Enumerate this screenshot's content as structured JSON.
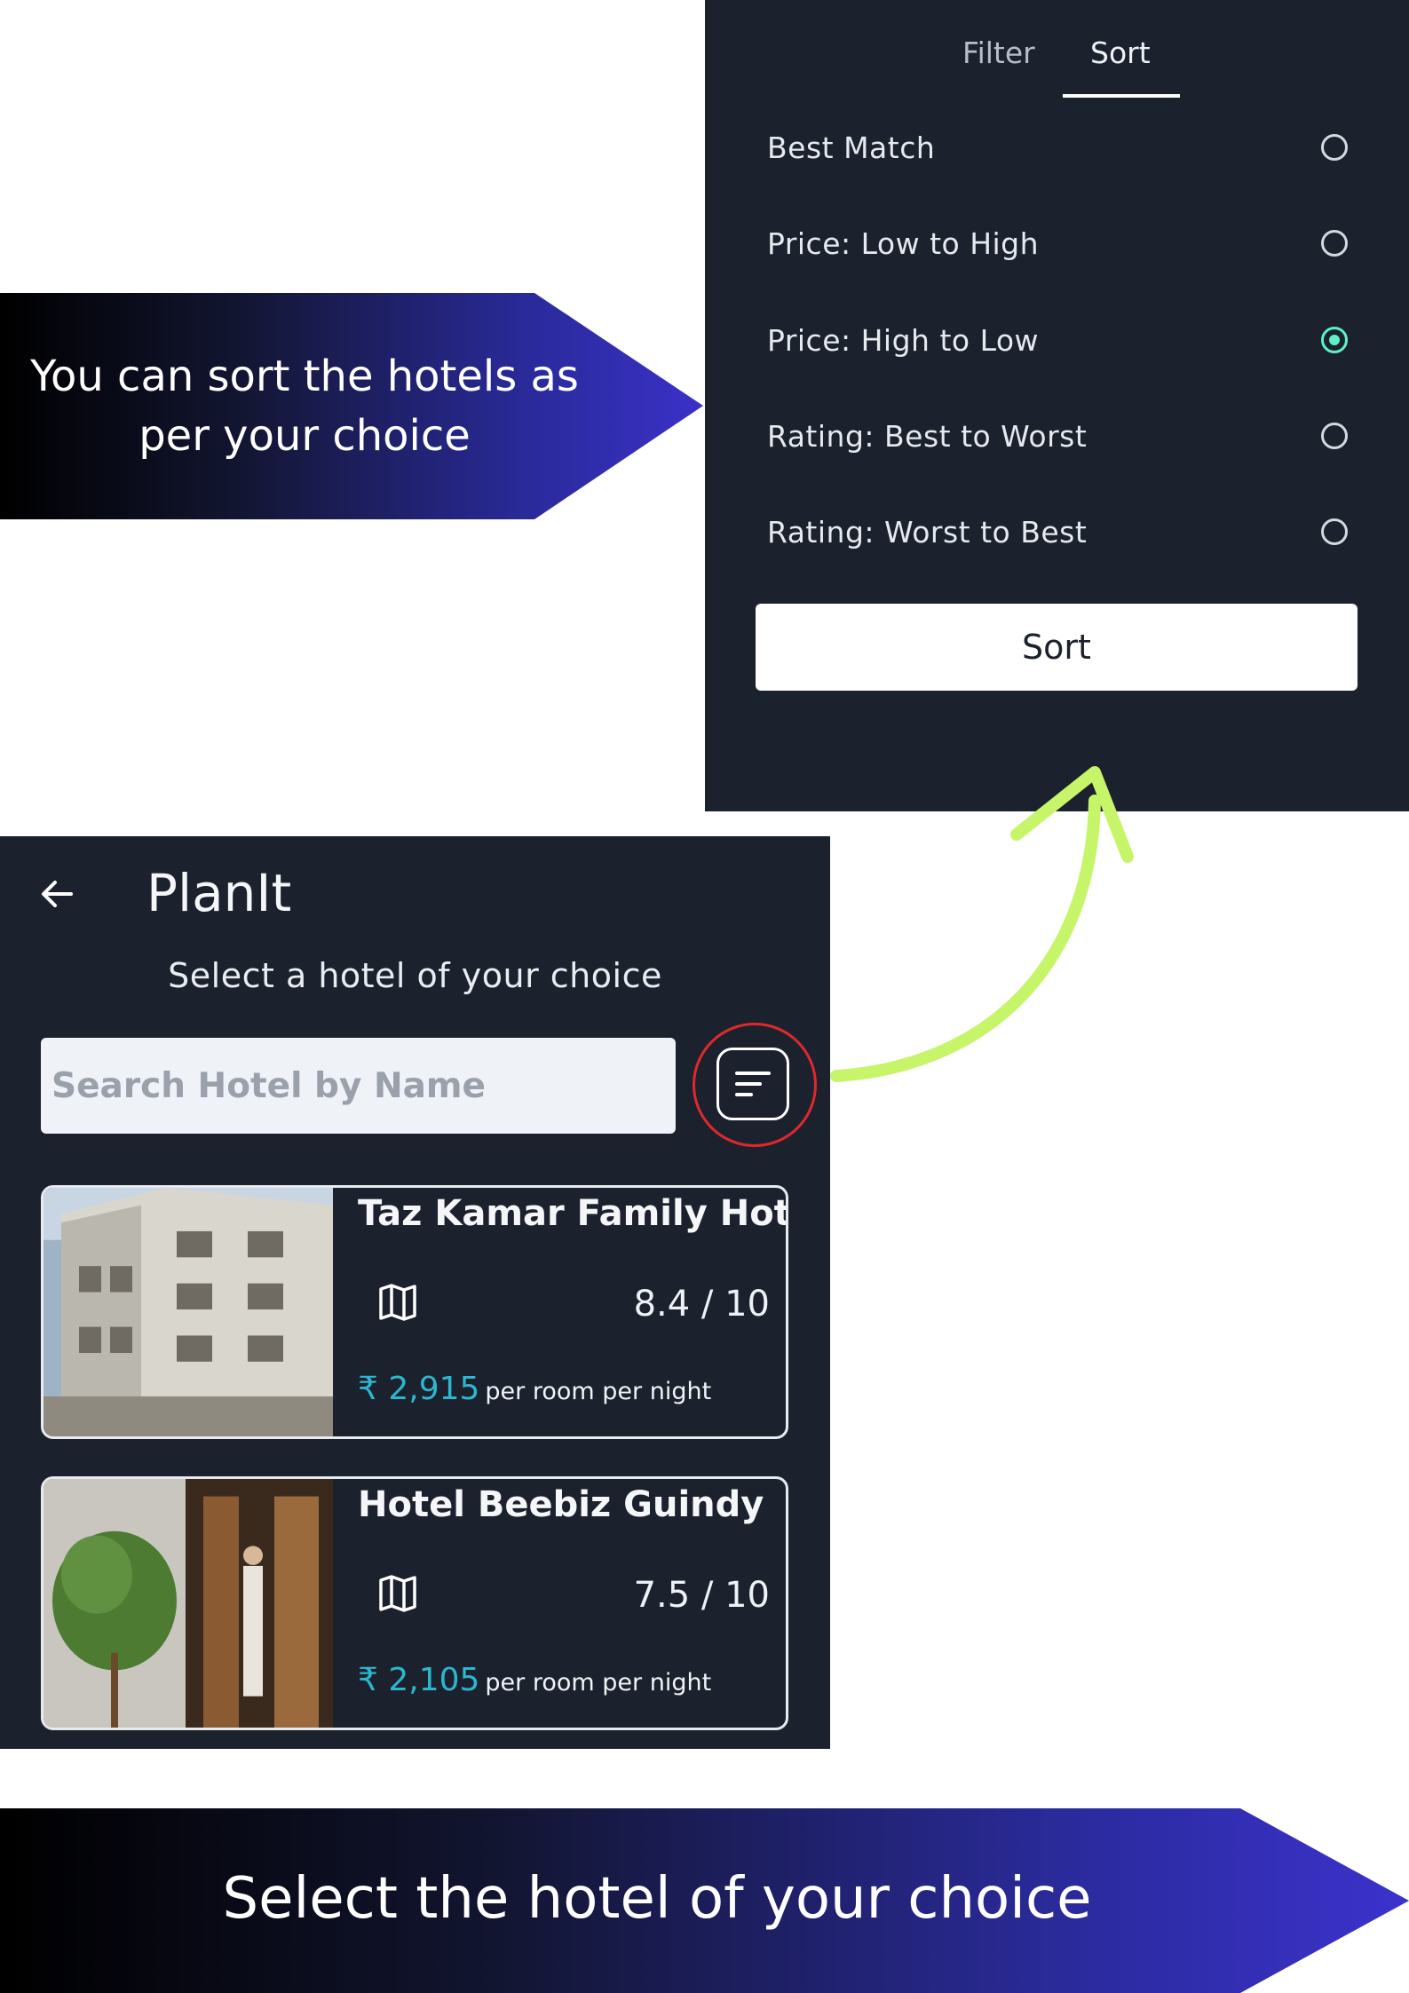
{
  "banners": {
    "top": "You can sort the hotels as per your choice",
    "bottom": "Select the hotel of your choice"
  },
  "sort_panel": {
    "tabs": [
      {
        "label": "Filter",
        "active": false
      },
      {
        "label": "Sort",
        "active": true
      }
    ],
    "options": [
      {
        "label": "Best Match",
        "selected": false
      },
      {
        "label": "Price: Low to High",
        "selected": false
      },
      {
        "label": "Price: High to Low",
        "selected": true
      },
      {
        "label": "Rating: Best to Worst",
        "selected": false
      },
      {
        "label": "Rating: Worst to Best",
        "selected": false
      }
    ],
    "button_label": "Sort",
    "accent_color": "#5ef0c6"
  },
  "app": {
    "title": "PlanIt",
    "subtitle": "Select a hotel of your choice",
    "search_placeholder": "Search Hotel by Name",
    "back_icon": "arrow-left-icon",
    "sort_icon": "sort-lines-icon",
    "hotels": [
      {
        "name": "Taz Kamar Family Hotel",
        "rating": "8.4 / 10",
        "price": "₹ 2,915",
        "per": "per room per night",
        "map_icon": "map-icon"
      },
      {
        "name": "Hotel Beebiz Guindy",
        "rating": "7.5 / 10",
        "price": "₹ 2,105",
        "per": "per room per night",
        "map_icon": "map-icon"
      }
    ]
  },
  "colors": {
    "panel_bg": "#1b222d",
    "price_color": "#2db6cf",
    "highlight_ring": "#e0282c",
    "arrow_color": "#c7f56a"
  }
}
